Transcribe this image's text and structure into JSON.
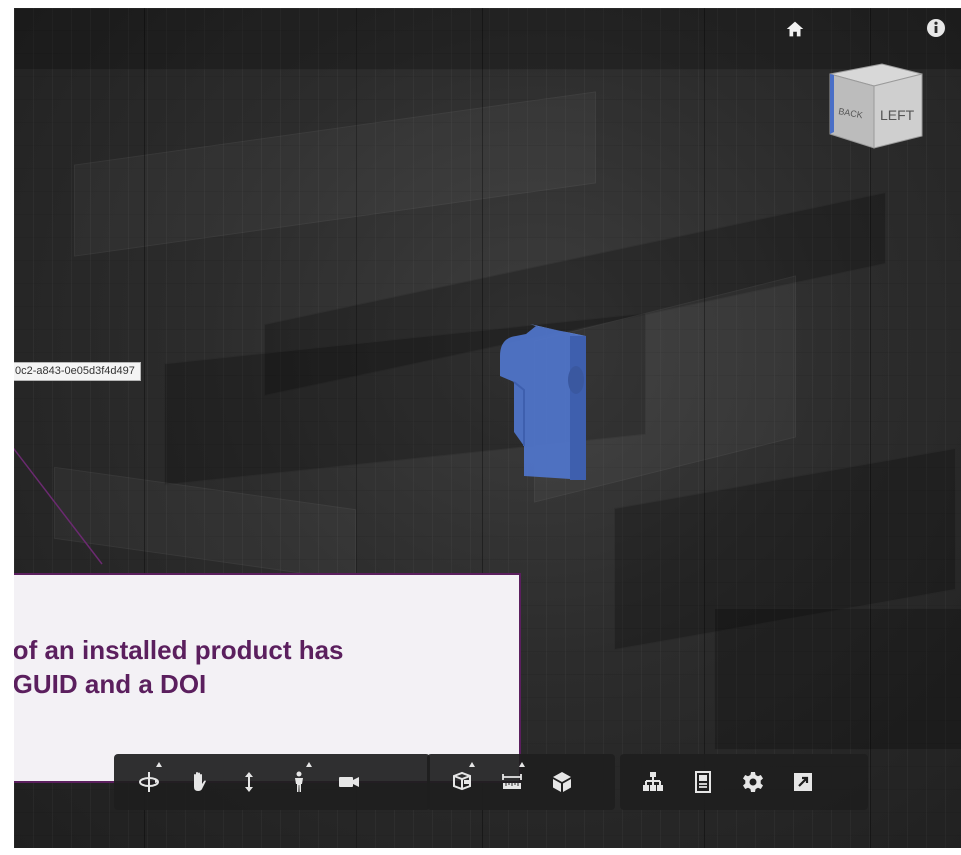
{
  "viewer": {
    "background_color": "#2c2c2c",
    "selection_color": "#4f74c8",
    "tooltip_text": "0c2-a843-0e05d3f4d497",
    "callout": {
      "line1": "e of an installed product has",
      "line2": "a GUID and a DOI",
      "text_color": "#5b1f5e",
      "border_color": "#5b1f5e"
    },
    "viewcube": {
      "face_left": "LEFT",
      "face_back": "BACK"
    },
    "top_icons": [
      "home-icon",
      "info-icon"
    ]
  },
  "toolbar": {
    "groups": [
      {
        "tools": [
          "orbit-icon",
          "pan-icon",
          "zoom-icon",
          "first-person-icon",
          "camera-icon"
        ]
      },
      {
        "tools": [
          "explode-icon",
          "measure-icon",
          "section-icon"
        ]
      },
      {
        "tools": [
          "model-browser-icon",
          "properties-icon",
          "settings-icon",
          "fullscreen-icon"
        ]
      }
    ]
  }
}
